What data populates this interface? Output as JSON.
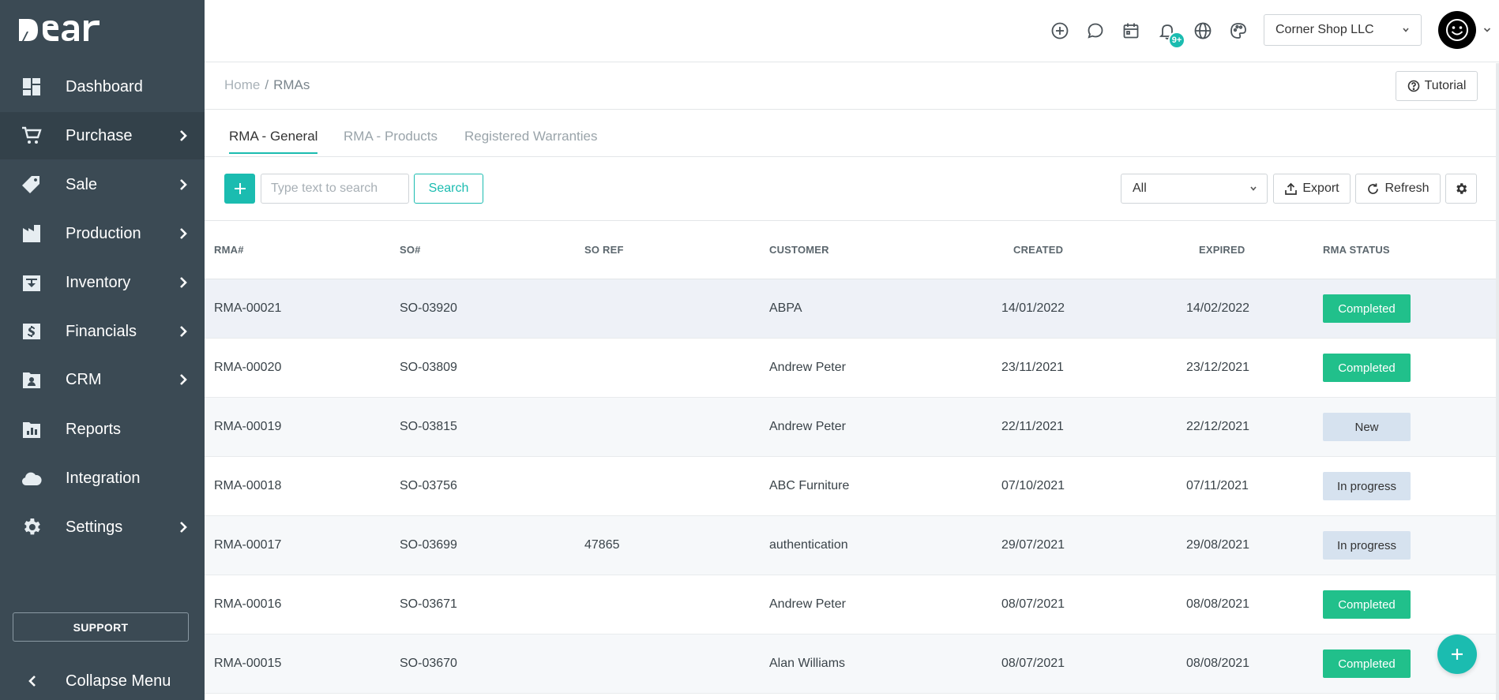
{
  "app": {
    "logo_text": "DEAR"
  },
  "sidebar": {
    "items": [
      {
        "label": "Dashboard",
        "icon": "dashboard-icon",
        "has_submenu": false
      },
      {
        "label": "Purchase",
        "icon": "cart-icon",
        "has_submenu": true,
        "active": true
      },
      {
        "label": "Sale",
        "icon": "tag-icon",
        "has_submenu": true
      },
      {
        "label": "Production",
        "icon": "factory-icon",
        "has_submenu": true
      },
      {
        "label": "Inventory",
        "icon": "inventory-box-icon",
        "has_submenu": true
      },
      {
        "label": "Financials",
        "icon": "dollar-icon",
        "has_submenu": true
      },
      {
        "label": "CRM",
        "icon": "contact-folder-icon",
        "has_submenu": true
      },
      {
        "label": "Reports",
        "icon": "reports-icon",
        "has_submenu": false
      },
      {
        "label": "Integration",
        "icon": "cloud-icon",
        "has_submenu": false
      },
      {
        "label": "Settings",
        "icon": "gear-icon",
        "has_submenu": true
      }
    ],
    "support_label": "SUPPORT",
    "collapse_label": "Collapse Menu"
  },
  "topbar": {
    "icons": [
      "add-circle-icon",
      "chat-icon",
      "calendar-icon",
      "bell-icon",
      "globe-icon",
      "palette-icon"
    ],
    "notification_badge": "9+",
    "company": "Corner Shop LLC"
  },
  "breadcrumb": {
    "home": "Home",
    "separator": "/",
    "current": "RMAs"
  },
  "tutorial_label": "Tutorial",
  "tabs": [
    {
      "label": "RMA - General",
      "active": true
    },
    {
      "label": "RMA - Products",
      "active": false
    },
    {
      "label": "Registered Warranties",
      "active": false
    }
  ],
  "toolbar": {
    "search_placeholder": "Type text to search",
    "search_label": "Search",
    "filter_value": "All",
    "export_label": "Export",
    "refresh_label": "Refresh"
  },
  "table": {
    "columns": [
      "RMA#",
      "SO#",
      "SO REF",
      "CUSTOMER",
      "CREATED",
      "EXPIRED",
      "RMA STATUS"
    ],
    "rows": [
      {
        "rma": "RMA-00021",
        "so": "SO-03920",
        "so_ref": "",
        "customer": "ABPA",
        "created": "14/01/2022",
        "expired": "14/02/2022",
        "status": "Completed"
      },
      {
        "rma": "RMA-00020",
        "so": "SO-03809",
        "so_ref": "",
        "customer": "Andrew Peter",
        "created": "23/11/2021",
        "expired": "23/12/2021",
        "status": "Completed"
      },
      {
        "rma": "RMA-00019",
        "so": "SO-03815",
        "so_ref": "",
        "customer": "Andrew Peter",
        "created": "22/11/2021",
        "expired": "22/12/2021",
        "status": "New"
      },
      {
        "rma": "RMA-00018",
        "so": "SO-03756",
        "so_ref": "",
        "customer": "ABC Furniture",
        "created": "07/10/2021",
        "expired": "07/11/2021",
        "status": "In progress"
      },
      {
        "rma": "RMA-00017",
        "so": "SO-03699",
        "so_ref": "47865",
        "customer": "authentication",
        "created": "29/07/2021",
        "expired": "29/08/2021",
        "status": "In progress"
      },
      {
        "rma": "RMA-00016",
        "so": "SO-03671",
        "so_ref": "",
        "customer": "Andrew Peter",
        "created": "08/07/2021",
        "expired": "08/08/2021",
        "status": "Completed"
      },
      {
        "rma": "RMA-00015",
        "so": "SO-03670",
        "so_ref": "",
        "customer": "Alan Williams",
        "created": "08/07/2021",
        "expired": "08/08/2021",
        "status": "Completed"
      }
    ]
  },
  "colors": {
    "accent": "#1bbcb0",
    "sidebar_bg": "#3b4a54",
    "status_completed_bg": "#21c08b",
    "status_new_bg": "#d6e2ef",
    "status_inprogress_bg": "#d6e2ef"
  }
}
